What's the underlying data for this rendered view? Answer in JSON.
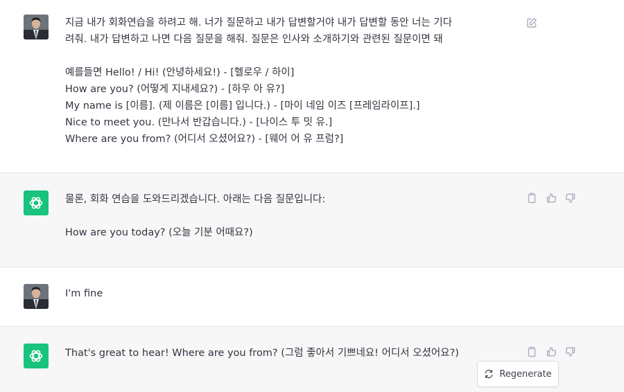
{
  "messages": [
    {
      "role": "user",
      "lines": [
        "지금 내가 회화연습을 하려고 해. 너가 질문하고 내가 답변할거야 내가 답변할 동안 너는 기다",
        "려줘. 내가 답변하고 나면 다음 질문을 해줘. 질문은 인사와 소개하기와 관련된 질문이면 돼",
        "",
        "예를들면 Hello! / Hi! (안녕하세요!) - [헬로우 / 하이]",
        "How are you? (어떻게 지내세요?) - [하우 아 유?]",
        "My name is [이름]. (제 이름은 [이름] 입니다.) - [마이 네임 이즈 [프레임라이프].]",
        "Nice to meet you. (만나서 반갑습니다.) - [나이스 투 밋 유.]",
        "Where are you from? (어디서 오셨어요?) - [웨어 어 유 프럼?]"
      ]
    },
    {
      "role": "assistant",
      "lines": [
        "물론, 회화 연습을 도와드리겠습니다. 아래는 다음 질문입니다:",
        "",
        "How are you today? (오늘 기분 어때요?)"
      ]
    },
    {
      "role": "user",
      "lines": [
        "I'm fine"
      ]
    },
    {
      "role": "assistant",
      "lines": [
        "That's great to hear! Where are you from? (그럼 좋아서 기쁘네요! 어디서 오셨어요?)"
      ]
    }
  ],
  "regenerate_label": "Regenerate",
  "colors": {
    "assistant_bg": "#f7f7f8",
    "bot_avatar": "#19c37d",
    "text": "#343541",
    "icon": "#acacbe"
  }
}
